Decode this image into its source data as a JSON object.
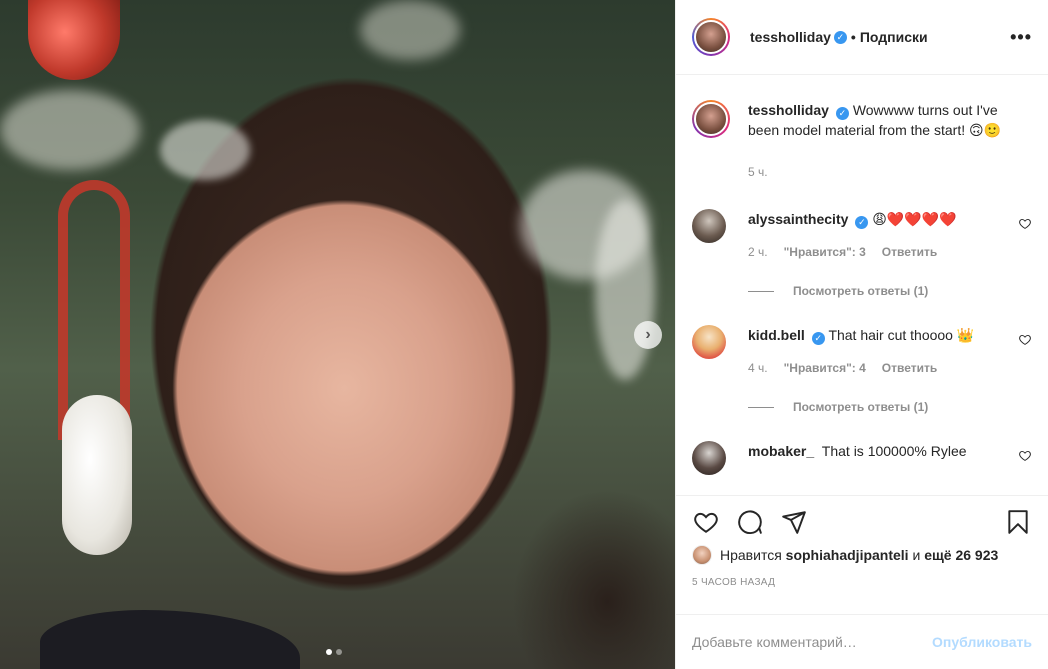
{
  "post": {
    "author": "tessholliday",
    "follow_separator": "•",
    "follow_label": "Подписки",
    "more_label": "•••",
    "photo_description_icon": "photo",
    "next_label": "›"
  },
  "caption": {
    "username": "tessholliday",
    "text": "Wowwww turns out I've been model material from the start! 🙃🙂",
    "time": "5 ч."
  },
  "comments": [
    {
      "username": "alyssainthecity",
      "verified": true,
      "text": "😩❤️❤️❤️❤️",
      "time": "2 ч.",
      "likes": "\"Нравится\": 3",
      "reply": "Ответить",
      "view_replies": "Посмотреть ответы (1)"
    },
    {
      "username": "kidd.bell",
      "verified": true,
      "text": "That hair cut thoooo 👑",
      "time": "4 ч.",
      "likes": "\"Нравится\": 4",
      "reply": "Ответить",
      "view_replies": "Посмотреть ответы (1)"
    },
    {
      "username": "mobaker_",
      "verified": false,
      "text": "That is 100000% Rylee",
      "time": "",
      "likes": "",
      "reply": "",
      "view_replies": ""
    }
  ],
  "likes": {
    "prefix": "Нравится",
    "user": "sophiahadjipanteli",
    "conj": "и",
    "rest": "ещё 26 923"
  },
  "timestamp": "5 ЧАСОВ НАЗАД",
  "comment_input": {
    "placeholder": "Добавьте комментарий…",
    "post_label": "Опубликовать"
  },
  "colors": {
    "verified": "#3897f0",
    "muted": "#8e8e8e",
    "post_disabled": "#b3dbff"
  }
}
